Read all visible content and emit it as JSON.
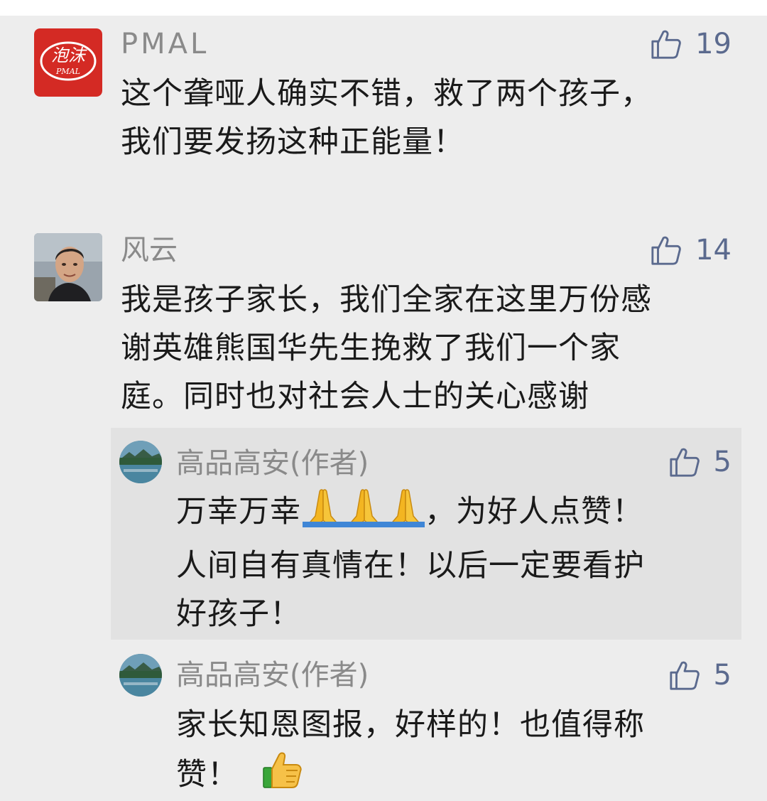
{
  "comments": [
    {
      "author": "PMAL",
      "avatar_icon": "paomo-logo-icon",
      "avatar_logo_text": "泡沫 PMAL",
      "likes": "19",
      "lines": [
        "这个聋哑人确实不错，救了两个孩子，",
        "我们要发扬这种正能量！"
      ]
    },
    {
      "author": "风云",
      "avatar_icon": "person-photo-avatar",
      "likes": "14",
      "lines": [
        "我是孩子家长，我们全家在这里万份感",
        "谢英雄熊国华先生挽救了我们一个家",
        "庭。同时也对社会人士的关心感谢"
      ]
    }
  ],
  "replies": [
    {
      "author": "高品高安(作者)",
      "avatar_icon": "landscape-avatar",
      "likes": "5",
      "line1_before": "万幸万幸",
      "line1_emoji": "folded-hands-emoji x3",
      "line1_after": "，为好人点赞！",
      "lines": [
        "人间自有真情在！以后一定要看护",
        "好孩子！"
      ]
    },
    {
      "author": "高品高安(作者)",
      "avatar_icon": "landscape-avatar",
      "likes": "5",
      "lines": [
        "家长知恩图报，好样的！也值得称",
        "赞！"
      ],
      "trailing_emoji": "thumbs-up-emoji"
    }
  ],
  "icons": {
    "like": "thumbs-up-outline-icon"
  },
  "colors": {
    "background": "#ededed",
    "reply_highlight": "#e2e2e2",
    "name": "#8a8a8a",
    "text": "#1a1a1a",
    "like": "#5b6a8e",
    "logo_red": "#d42a24"
  }
}
